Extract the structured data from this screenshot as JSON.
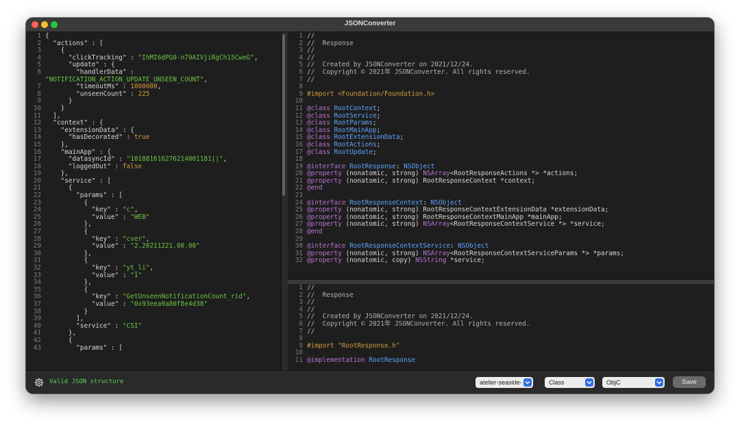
{
  "window": {
    "title": "JSONConverter"
  },
  "json_lines": [
    [
      [
        "p",
        "{"
      ]
    ],
    [
      [
        "p",
        "  "
      ],
      [
        "key",
        "\"actions\""
      ],
      [
        "p",
        " : ["
      ]
    ],
    [
      [
        "p",
        "    {"
      ]
    ],
    [
      [
        "p",
        "      "
      ],
      [
        "key",
        "\"clickTracking\""
      ],
      [
        "p",
        " : "
      ],
      [
        "str",
        "\"IhMI6dPG0-n79AIVjiRgCh15CweG\""
      ],
      [
        "p",
        ","
      ]
    ],
    [
      [
        "p",
        "      "
      ],
      [
        "key",
        "\"update\""
      ],
      [
        "p",
        " : {"
      ]
    ],
    [
      [
        "p",
        "        "
      ],
      [
        "key",
        "\"handlerData\""
      ],
      [
        "p",
        " :"
      ]
    ],
    [
      [
        "str",
        "\"NOTIFICATION_ACTION_UPDATE_UNSEEN_COUNT\""
      ],
      [
        "p",
        ","
      ]
    ],
    [
      [
        "p",
        "        "
      ],
      [
        "key",
        "\"timeoutMs\""
      ],
      [
        "p",
        " : "
      ],
      [
        "num",
        "1800000"
      ],
      [
        "p",
        ","
      ]
    ],
    [
      [
        "p",
        "        "
      ],
      [
        "key",
        "\"unseenCount\""
      ],
      [
        "p",
        " : "
      ],
      [
        "num",
        "225"
      ]
    ],
    [
      [
        "p",
        "      }"
      ]
    ],
    [
      [
        "p",
        "    }"
      ]
    ],
    [
      [
        "p",
        "  ],"
      ]
    ],
    [
      [
        "p",
        "  "
      ],
      [
        "key",
        "\"context\""
      ],
      [
        "p",
        " : {"
      ]
    ],
    [
      [
        "p",
        "    "
      ],
      [
        "key",
        "\"extensionData\""
      ],
      [
        "p",
        " : {"
      ]
    ],
    [
      [
        "p",
        "      "
      ],
      [
        "key",
        "\"hasDecorated\""
      ],
      [
        "p",
        " : "
      ],
      [
        "bool",
        "true"
      ]
    ],
    [
      [
        "p",
        "    },"
      ]
    ],
    [
      [
        "p",
        "    "
      ],
      [
        "key",
        "\"mainApp\""
      ],
      [
        "p",
        " : {"
      ]
    ],
    [
      [
        "p",
        "      "
      ],
      [
        "key",
        "\"datasyncId\""
      ],
      [
        "p",
        " : "
      ],
      [
        "str",
        "\"101881616276214001181||\""
      ],
      [
        "p",
        ","
      ]
    ],
    [
      [
        "p",
        "      "
      ],
      [
        "key",
        "\"loggedOut\""
      ],
      [
        "p",
        " : "
      ],
      [
        "bool",
        "false"
      ]
    ],
    [
      [
        "p",
        "    },"
      ]
    ],
    [
      [
        "p",
        "    "
      ],
      [
        "key",
        "\"service\""
      ],
      [
        "p",
        " : ["
      ]
    ],
    [
      [
        "p",
        "      {"
      ]
    ],
    [
      [
        "p",
        "        "
      ],
      [
        "key",
        "\"params\""
      ],
      [
        "p",
        " : ["
      ]
    ],
    [
      [
        "p",
        "          {"
      ]
    ],
    [
      [
        "p",
        "            "
      ],
      [
        "key",
        "\"key\""
      ],
      [
        "p",
        " : "
      ],
      [
        "str",
        "\"c\""
      ],
      [
        "p",
        ","
      ]
    ],
    [
      [
        "p",
        "            "
      ],
      [
        "key",
        "\"value\""
      ],
      [
        "p",
        " : "
      ],
      [
        "str",
        "\"WEB\""
      ]
    ],
    [
      [
        "p",
        "          },"
      ]
    ],
    [
      [
        "p",
        "          {"
      ]
    ],
    [
      [
        "p",
        "            "
      ],
      [
        "key",
        "\"key\""
      ],
      [
        "p",
        " : "
      ],
      [
        "str",
        "\"cver\""
      ],
      [
        "p",
        ","
      ]
    ],
    [
      [
        "p",
        "            "
      ],
      [
        "key",
        "\"value\""
      ],
      [
        "p",
        " : "
      ],
      [
        "str",
        "\"2.20211221.00.00\""
      ]
    ],
    [
      [
        "p",
        "          },"
      ]
    ],
    [
      [
        "p",
        "          {"
      ]
    ],
    [
      [
        "p",
        "            "
      ],
      [
        "key",
        "\"key\""
      ],
      [
        "p",
        " : "
      ],
      [
        "str",
        "\"yt_li\""
      ],
      [
        "p",
        ","
      ]
    ],
    [
      [
        "p",
        "            "
      ],
      [
        "key",
        "\"value\""
      ],
      [
        "p",
        " : "
      ],
      [
        "str",
        "\"1\""
      ]
    ],
    [
      [
        "p",
        "          },"
      ]
    ],
    [
      [
        "p",
        "          {"
      ]
    ],
    [
      [
        "p",
        "            "
      ],
      [
        "key",
        "\"key\""
      ],
      [
        "p",
        " : "
      ],
      [
        "str",
        "\"GetUnseenNotificationCount_rid\""
      ],
      [
        "p",
        ","
      ]
    ],
    [
      [
        "p",
        "            "
      ],
      [
        "key",
        "\"value\""
      ],
      [
        "p",
        " : "
      ],
      [
        "str",
        "\"0x93eea9a80f8e4d38\""
      ]
    ],
    [
      [
        "p",
        "          }"
      ]
    ],
    [
      [
        "p",
        "        ],"
      ]
    ],
    [
      [
        "p",
        "        "
      ],
      [
        "key",
        "\"service\""
      ],
      [
        "p",
        " : "
      ],
      [
        "str",
        "\"CSI\""
      ]
    ],
    [
      [
        "p",
        "      },"
      ]
    ],
    [
      [
        "p",
        "      {"
      ]
    ],
    [
      [
        "p",
        "        "
      ],
      [
        "key",
        "\"params\""
      ],
      [
        "p",
        " : ["
      ]
    ]
  ],
  "json_line_numbers": [
    "1",
    "2",
    "3",
    "4",
    "5",
    "6",
    "",
    "7",
    "8",
    "9",
    "10",
    "11",
    "12",
    "13",
    "14",
    "15",
    "16",
    "17",
    "18",
    "19",
    "20",
    "21",
    "22",
    "23",
    "24",
    "25",
    "26",
    "27",
    "28",
    "29",
    "30",
    "31",
    "32",
    "33",
    "34",
    "35",
    "36",
    "37",
    "38",
    "39",
    "40",
    "41",
    "42",
    "43"
  ],
  "header_lines": [
    [
      [
        "com",
        "//"
      ]
    ],
    [
      [
        "com",
        "//  Response"
      ]
    ],
    [
      [
        "com",
        "//"
      ]
    ],
    [
      [
        "com",
        "//"
      ]
    ],
    [
      [
        "com",
        "//  Created by JSONConverter on 2021/12/24."
      ]
    ],
    [
      [
        "com",
        "//  Copyright © 2021年 JSONConverter. All rights reserved."
      ]
    ],
    [
      [
        "com",
        "//"
      ]
    ],
    [],
    [
      [
        "dir",
        "#import <Foundation/Foundation.h>"
      ]
    ],
    [],
    [
      [
        "kw",
        "@class "
      ],
      [
        "cls",
        "RootContext"
      ],
      [
        "txt",
        ";"
      ]
    ],
    [
      [
        "kw",
        "@class "
      ],
      [
        "cls",
        "RootService"
      ],
      [
        "txt",
        ";"
      ]
    ],
    [
      [
        "kw",
        "@class "
      ],
      [
        "cls",
        "RootParams"
      ],
      [
        "txt",
        ";"
      ]
    ],
    [
      [
        "kw",
        "@class "
      ],
      [
        "cls",
        "RootMainApp"
      ],
      [
        "txt",
        ";"
      ]
    ],
    [
      [
        "kw",
        "@class "
      ],
      [
        "cls",
        "RootExtensionData"
      ],
      [
        "txt",
        ";"
      ]
    ],
    [
      [
        "kw",
        "@class "
      ],
      [
        "cls",
        "RootActions"
      ],
      [
        "txt",
        ";"
      ]
    ],
    [
      [
        "kw",
        "@class "
      ],
      [
        "cls",
        "RootUpdate"
      ],
      [
        "txt",
        ";"
      ]
    ],
    [],
    [
      [
        "kw",
        "@interface "
      ],
      [
        "cls",
        "RootResponse"
      ],
      [
        "txt",
        ": "
      ],
      [
        "cls",
        "NSObject"
      ]
    ],
    [
      [
        "kw",
        "@property "
      ],
      [
        "txt",
        "(nonatomic, strong) "
      ],
      [
        "kw",
        "NSArray"
      ],
      [
        "txt",
        "<RootResponseActions *> *actions;"
      ]
    ],
    [
      [
        "kw",
        "@property "
      ],
      [
        "txt",
        "(nonatomic, strong) RootResponseContext *context;"
      ]
    ],
    [
      [
        "kw",
        "@end"
      ]
    ],
    [],
    [
      [
        "kw",
        "@interface "
      ],
      [
        "cls",
        "RootResponseContext"
      ],
      [
        "txt",
        ": "
      ],
      [
        "cls",
        "NSObject"
      ]
    ],
    [
      [
        "kw",
        "@property "
      ],
      [
        "txt",
        "(nonatomic, strong) RootResponseContextExtensionData *extensionData;"
      ]
    ],
    [
      [
        "kw",
        "@property "
      ],
      [
        "txt",
        "(nonatomic, strong) RootResponseContextMainApp *mainApp;"
      ]
    ],
    [
      [
        "kw",
        "@property "
      ],
      [
        "txt",
        "(nonatomic, strong) "
      ],
      [
        "kw",
        "NSArray"
      ],
      [
        "txt",
        "<RootResponseContextService *> *service;"
      ]
    ],
    [
      [
        "kw",
        "@end"
      ]
    ],
    [],
    [
      [
        "kw",
        "@interface "
      ],
      [
        "cls",
        "RootResponseContextService"
      ],
      [
        "txt",
        ": "
      ],
      [
        "cls",
        "NSObject"
      ]
    ],
    [
      [
        "kw",
        "@property "
      ],
      [
        "txt",
        "(nonatomic, strong) "
      ],
      [
        "kw",
        "NSArray"
      ],
      [
        "txt",
        "<RootResponseContextServiceParams *> *params;"
      ]
    ],
    [
      [
        "kw",
        "@property "
      ],
      [
        "txt",
        "(nonatomic, copy) "
      ],
      [
        "kw",
        "NSString"
      ],
      [
        "txt",
        " *service;"
      ]
    ]
  ],
  "impl_lines": [
    [
      [
        "com",
        "//"
      ]
    ],
    [
      [
        "com",
        "//  Response"
      ]
    ],
    [
      [
        "com",
        "//"
      ]
    ],
    [
      [
        "com",
        "//"
      ]
    ],
    [
      [
        "com",
        "//  Created by JSONConverter on 2021/12/24."
      ]
    ],
    [
      [
        "com",
        "//  Copyright © 2021年 JSONConverter. All rights reserved."
      ]
    ],
    [
      [
        "com",
        "//"
      ]
    ],
    [],
    [
      [
        "dir",
        "#import \"RootResponse.h\""
      ]
    ],
    [],
    [
      [
        "kw",
        "@implementation "
      ],
      [
        "cls",
        "RootResponse"
      ]
    ]
  ],
  "statusbar": {
    "gear_icon": "gear-icon",
    "status_text": "Valid JSON structure",
    "theme_select": "atelier-seaside-",
    "type_select": "Class",
    "lang_select": "ObjC",
    "save_label": "Save"
  }
}
